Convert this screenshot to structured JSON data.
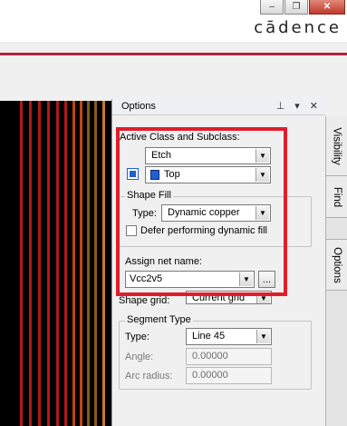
{
  "window": {
    "minimize_glyph": "–",
    "restore_glyph": "❐",
    "close_glyph": "✕"
  },
  "brand": {
    "name": "cādence"
  },
  "canvas": {
    "stripe_colors": [
      "#b01818",
      "#b01818",
      "#b01818",
      "#b01818",
      "#b01818",
      "#b01818",
      "#c0460f",
      "#c0460f",
      "#8a5a1a",
      "#8a5a1a",
      "#c97a24"
    ]
  },
  "panel": {
    "title": "Options",
    "tool_glyphs": "⊥ ▾ ✕",
    "active_class_label": "Active Class and Subclass:",
    "class_value": "Etch",
    "subclass_value": "Top",
    "shape_fill": {
      "title": "Shape Fill",
      "type_label": "Type:",
      "type_value": "Dynamic copper",
      "defer_label": "Defer performing dynamic fill",
      "defer_checked": false
    },
    "assign_net_label": "Assign net name:",
    "net_value": "Vcc2v5",
    "browse_label": "...",
    "shape_grid_label": "Shape grid:",
    "shape_grid_value": "Current grid",
    "segment_type": {
      "title": "Segment Type",
      "type_label": "Type:",
      "type_value": "Line 45",
      "angle_label": "Angle:",
      "angle_value": "0.00000",
      "arc_radius_label": "Arc radius:",
      "arc_radius_value": "0.00000"
    }
  },
  "side_tabs": [
    "Visibility",
    "Find",
    "Options"
  ],
  "colors": {
    "highlight_red": "#e11d2a",
    "subclass_swatch": "#1f5fd0"
  }
}
